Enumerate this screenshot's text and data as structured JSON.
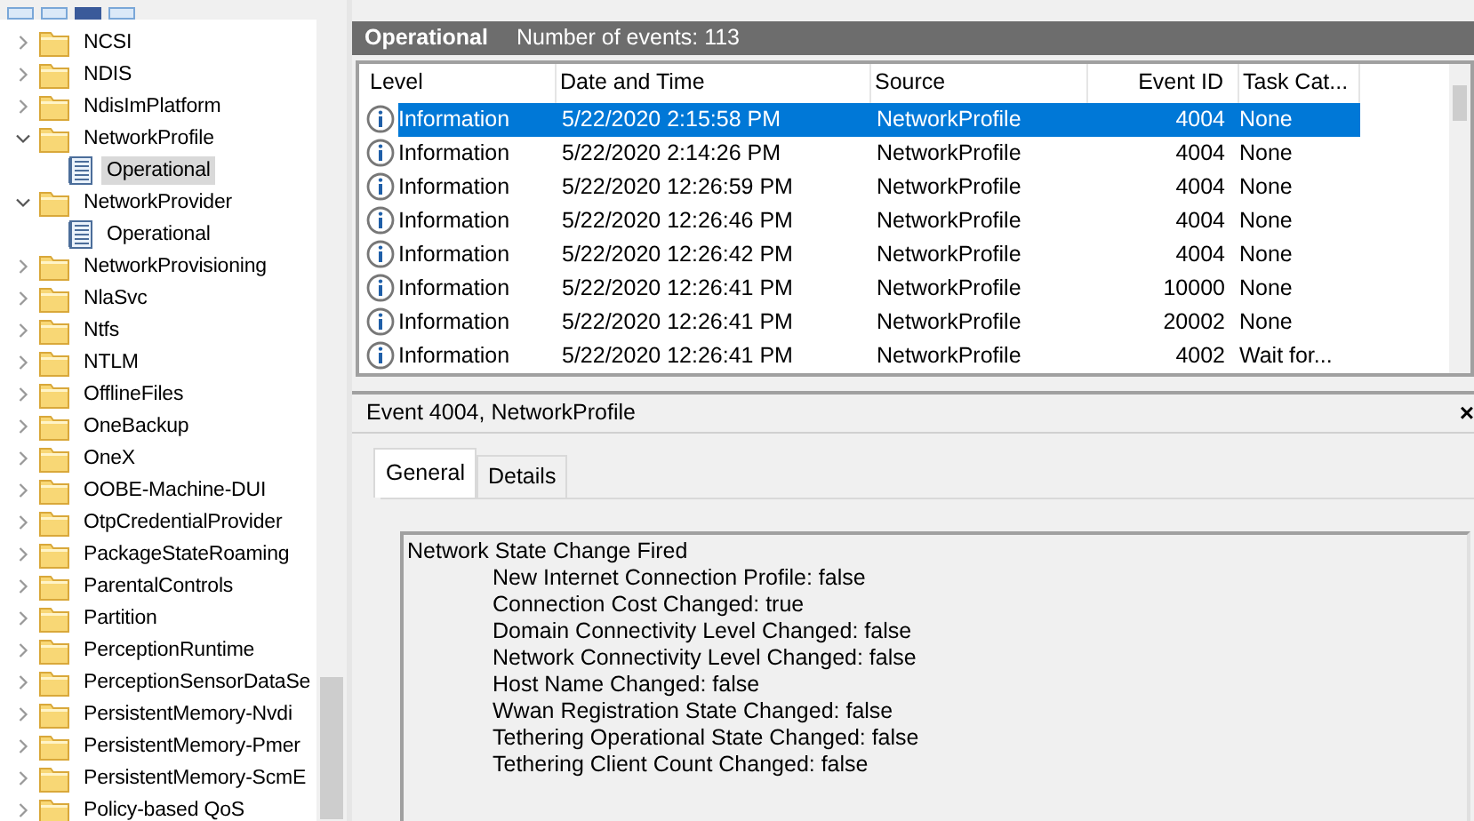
{
  "tree": [
    {
      "label": "NCSI",
      "kind": "folder",
      "expanded": false,
      "selected": false
    },
    {
      "label": "NDIS",
      "kind": "folder",
      "expanded": false,
      "selected": false
    },
    {
      "label": "NdisImPlatform",
      "kind": "folder",
      "expanded": false,
      "selected": false
    },
    {
      "label": "NetworkProfile",
      "kind": "folder",
      "expanded": true,
      "selected": false,
      "children": [
        {
          "label": "Operational",
          "kind": "log",
          "selected": true
        }
      ]
    },
    {
      "label": "NetworkProvider",
      "kind": "folder",
      "expanded": true,
      "selected": false,
      "children": [
        {
          "label": "Operational",
          "kind": "log",
          "selected": false
        }
      ]
    },
    {
      "label": "NetworkProvisioning",
      "kind": "folder",
      "expanded": false,
      "selected": false
    },
    {
      "label": "NlaSvc",
      "kind": "folder",
      "expanded": false,
      "selected": false
    },
    {
      "label": "Ntfs",
      "kind": "folder",
      "expanded": false,
      "selected": false
    },
    {
      "label": "NTLM",
      "kind": "folder",
      "expanded": false,
      "selected": false
    },
    {
      "label": "OfflineFiles",
      "kind": "folder",
      "expanded": false,
      "selected": false
    },
    {
      "label": "OneBackup",
      "kind": "folder",
      "expanded": false,
      "selected": false
    },
    {
      "label": "OneX",
      "kind": "folder",
      "expanded": false,
      "selected": false
    },
    {
      "label": "OOBE-Machine-DUI",
      "kind": "folder",
      "expanded": false,
      "selected": false
    },
    {
      "label": "OtpCredentialProvider",
      "kind": "folder",
      "expanded": false,
      "selected": false
    },
    {
      "label": "PackageStateRoaming",
      "kind": "folder",
      "expanded": false,
      "selected": false
    },
    {
      "label": "ParentalControls",
      "kind": "folder",
      "expanded": false,
      "selected": false
    },
    {
      "label": "Partition",
      "kind": "folder",
      "expanded": false,
      "selected": false
    },
    {
      "label": "PerceptionRuntime",
      "kind": "folder",
      "expanded": false,
      "selected": false
    },
    {
      "label": "PerceptionSensorDataSe",
      "kind": "folder",
      "expanded": false,
      "selected": false
    },
    {
      "label": "PersistentMemory-Nvdi",
      "kind": "folder",
      "expanded": false,
      "selected": false
    },
    {
      "label": "PersistentMemory-Pmer",
      "kind": "folder",
      "expanded": false,
      "selected": false
    },
    {
      "label": "PersistentMemory-ScmE",
      "kind": "folder",
      "expanded": false,
      "selected": false
    },
    {
      "label": "Policy-based QoS",
      "kind": "folder",
      "expanded": false,
      "selected": false
    }
  ],
  "log_header": {
    "title": "Operational",
    "count": "Number of events: 113"
  },
  "events": {
    "columns": [
      "Level",
      "Date and Time",
      "Source",
      "Event ID",
      "Task Cat..."
    ],
    "rows": [
      {
        "level": "Information",
        "date": "5/22/2020 2:15:58 PM",
        "source": "NetworkProfile",
        "event_id": "4004",
        "task_category": "None",
        "selected": true
      },
      {
        "level": "Information",
        "date": "5/22/2020 2:14:26 PM",
        "source": "NetworkProfile",
        "event_id": "4004",
        "task_category": "None",
        "selected": false
      },
      {
        "level": "Information",
        "date": "5/22/2020 12:26:59 PM",
        "source": "NetworkProfile",
        "event_id": "4004",
        "task_category": "None",
        "selected": false
      },
      {
        "level": "Information",
        "date": "5/22/2020 12:26:46 PM",
        "source": "NetworkProfile",
        "event_id": "4004",
        "task_category": "None",
        "selected": false
      },
      {
        "level": "Information",
        "date": "5/22/2020 12:26:42 PM",
        "source": "NetworkProfile",
        "event_id": "4004",
        "task_category": "None",
        "selected": false
      },
      {
        "level": "Information",
        "date": "5/22/2020 12:26:41 PM",
        "source": "NetworkProfile",
        "event_id": "10000",
        "task_category": "None",
        "selected": false
      },
      {
        "level": "Information",
        "date": "5/22/2020 12:26:41 PM",
        "source": "NetworkProfile",
        "event_id": "20002",
        "task_category": "None",
        "selected": false
      },
      {
        "level": "Information",
        "date": "5/22/2020 12:26:41 PM",
        "source": "NetworkProfile",
        "event_id": "4002",
        "task_category": "Wait for...",
        "selected": false
      }
    ]
  },
  "detail": {
    "title": "Event 4004, NetworkProfile",
    "close": "×",
    "tabs": [
      {
        "label": "General",
        "selected": true
      },
      {
        "label": "Details",
        "selected": false
      }
    ],
    "heading": "Network State Change Fired",
    "lines": [
      "New Internet Connection Profile: false",
      "Connection Cost Changed: true",
      "Domain Connectivity Level Changed: false",
      "Network Connectivity Level Changed: false",
      "Host Name Changed: false",
      "Wwan Registration State Changed: false",
      "Tethering Operational State Changed: false",
      "Tethering Client Count Changed: false"
    ]
  }
}
